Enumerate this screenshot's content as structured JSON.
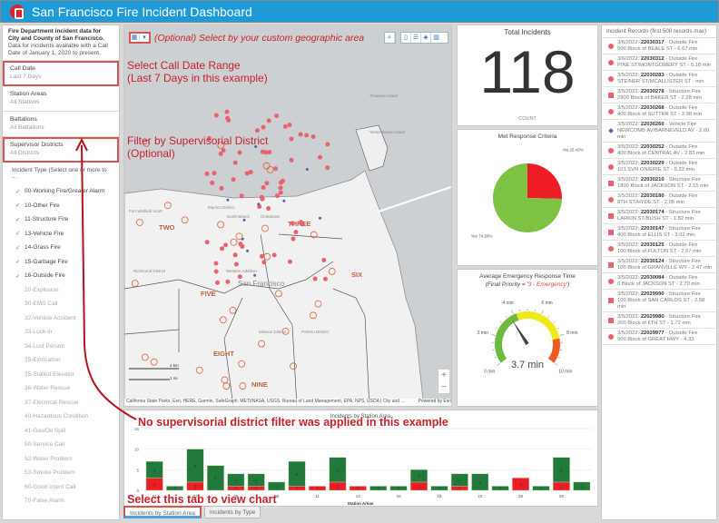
{
  "header": {
    "title": "San Francisco Fire Incident Dashboard"
  },
  "sidebar": {
    "intro_bold": "Fire Department incident data for City and County of San Francisco.",
    "intro": "Data for incidents available with a Call Date of January 1, 2020 to present.",
    "filters": [
      {
        "label": "Call Date",
        "value": "Last 7 Days"
      },
      {
        "label": "Station Areas",
        "value": "All Stations"
      },
      {
        "label": "Battalions",
        "value": "All Battalions"
      },
      {
        "label": "Supervisor Districts",
        "value": "All Districts"
      }
    ],
    "incident_type_label": "Incident Type (Select one or more to ...",
    "types": [
      {
        "label": "00-Working Fire/Greater Alarm",
        "checked": true
      },
      {
        "label": "10-Other Fire",
        "checked": true
      },
      {
        "label": "11-Structure Fire",
        "checked": true
      },
      {
        "label": "13-Vehicle Fire",
        "checked": true
      },
      {
        "label": "14-Grass Fire",
        "checked": true
      },
      {
        "label": "15-Garbage Fire",
        "checked": true
      },
      {
        "label": "16-Outside Fire",
        "checked": true
      },
      {
        "label": "20-Explosion",
        "checked": false
      },
      {
        "label": "30-EMS Call",
        "checked": false
      },
      {
        "label": "32-Vehicle Accident",
        "checked": false
      },
      {
        "label": "33-Lock-in",
        "checked": false
      },
      {
        "label": "34-Lost Person",
        "checked": false
      },
      {
        "label": "35-Extrication",
        "checked": false
      },
      {
        "label": "35-Stalled Elevator",
        "checked": false
      },
      {
        "label": "36-Water Rescue",
        "checked": false
      },
      {
        "label": "37-Electrical Rescue",
        "checked": false
      },
      {
        "label": "40-Hazardous Condition",
        "checked": false
      },
      {
        "label": "41-Gas/Oil Spill",
        "checked": false
      },
      {
        "label": "50-Service Call",
        "checked": false
      },
      {
        "label": "52-Water Problem",
        "checked": false
      },
      {
        "label": "53-Smoke Problem",
        "checked": false
      },
      {
        "label": "60-Good Intent Call",
        "checked": false
      },
      {
        "label": "70-False Alarm",
        "checked": false
      }
    ]
  },
  "map": {
    "districts": [
      "TWO",
      "THREE",
      "FIVE",
      "SIX",
      "EIGHT",
      "NINE"
    ],
    "places": [
      "Marina District",
      "North Beach",
      "Chinatown",
      "Fort Winfield Scott",
      "Richmond District",
      "Western Addition",
      "San Francisco",
      "Mission District",
      "Potrero District",
      "Treasure Island",
      "Yerba Buena Island"
    ],
    "scale": [
      "2 km",
      "1 mi"
    ],
    "attribution": "California State Parks, Esri, HERE, Garmin, SafeGraph, METI/NASA, USGS, Bureau of Land Management, EPA, NPS, USDA | City and ...",
    "powered": "Powered by Esri",
    "zoom_in": "+",
    "zoom_out": "−"
  },
  "annotations": {
    "geo": "(Optional) Select by your custom geographic area",
    "date1": "Select Call Date Range",
    "date2": "(Last 7 Days in this example)",
    "dist1": "Filter by Supervisorial District",
    "dist2": "(Optional)",
    "nofilter": "No supervisorial district filter was applied in this example",
    "tab": "Select this tab to view chart"
  },
  "total": {
    "title": "Total Incidents",
    "value": "118",
    "caption": "COUNT"
  },
  "pie": {
    "title": "Met Response Criteria",
    "slices": [
      {
        "label": "No",
        "pct": 25.42,
        "text": "No 25.42%",
        "color": "#ee1c25"
      },
      {
        "label": "Yes",
        "pct": 74.58,
        "text": "Yes 74.58%",
        "color": "#7dc243"
      }
    ]
  },
  "gauge": {
    "title": "Average Emergency Response Time",
    "subtitle_pre": "(Final Priority = '",
    "subtitle_hl": "3 - Emergency",
    "subtitle_post": "')",
    "value": 3.7,
    "value_text": "3.7 min",
    "min": 0,
    "max": 10,
    "ticks": [
      "0 min",
      "2 min",
      "4 min",
      "6 min",
      "8 min",
      "10 min"
    ],
    "bands": [
      {
        "from": 0,
        "to": 4.2,
        "color": "#6cbb3c"
      },
      {
        "from": 4.2,
        "to": 8.2,
        "color": "#eeea1a"
      },
      {
        "from": 8.2,
        "to": 10,
        "color": "#f05a22"
      }
    ]
  },
  "records": {
    "title": "Incident Records (first 500 records max)",
    "items": [
      {
        "date": "3/6/2022:",
        "id": "22030317",
        "type": " - Outside Fire",
        "loc": "500 Block of BEALE ST - 6.67 min",
        "shape": "circle"
      },
      {
        "date": "3/6/2022:",
        "id": "22030312",
        "type": " - Outside Fire",
        "loc": "PINE ST/MONTGOMERY ST - 5.18 min",
        "shape": "circle"
      },
      {
        "date": "3/5/2022:",
        "id": "22030283",
        "type": " - Outside Fire",
        "loc": "STEINER ST/MCALLISTER ST -  min",
        "shape": "circle"
      },
      {
        "date": "3/5/2022:",
        "id": "22030278",
        "type": " - Structure Fire",
        "loc": "2900 Block of BAKER ST - 2.28 min",
        "shape": "square"
      },
      {
        "date": "3/5/2022:",
        "id": "22030268",
        "type": " - Outside Fire",
        "loc": "400 Block of SUTTER ST - 3.98 min",
        "shape": "circle"
      },
      {
        "date": "3/5/2022:",
        "id": "22030260",
        "type": " - Vehicle Fire",
        "loc": "NEWCOMB AV/BARNEVELD AV - 2.60 min",
        "shape": "diamond"
      },
      {
        "date": "3/5/2022:",
        "id": "22030252",
        "type": " - Outside Fire",
        "loc": "400 Block of CENTRAL AV - 2.83 min",
        "shape": "circle"
      },
      {
        "date": "3/5/2022:",
        "id": "22030229",
        "type": " - Outside Fire",
        "loc": "101 SVN ON/ERIE ST - 5.22 min",
        "shape": "circle"
      },
      {
        "date": "3/5/2022:",
        "id": "22030210",
        "type": " - Structure Fire",
        "loc": "1800 Block of JACKSON ST - 2.15 min",
        "shape": "square"
      },
      {
        "date": "3/5/2022:",
        "id": "22030180",
        "type": " - Outside Fire",
        "loc": "8TH ST/HYDE ST - 2.05 min",
        "shape": "circle"
      },
      {
        "date": "3/5/2022:",
        "id": "22030174",
        "type": " - Structure Fire",
        "loc": "LARKIN ST/BUSH ST - 1.82 min",
        "shape": "square"
      },
      {
        "date": "3/5/2022:",
        "id": "22030147",
        "type": " - Structure Fire",
        "loc": "400 Block of ELLIS ST - 3.02 min",
        "shape": "square"
      },
      {
        "date": "3/5/2022:",
        "id": "22030125",
        "type": " - Outside Fire",
        "loc": "100 Block of FULTON ST - 2.67 min",
        "shape": "circle"
      },
      {
        "date": "3/5/2022:",
        "id": "22030124",
        "type": " - Structure Fire",
        "loc": "100 Block of GRANVILLE WY - 2.47 min",
        "shape": "square"
      },
      {
        "date": "3/5/2022:",
        "id": "22030084",
        "type": " - Outside Fire",
        "loc": "0 Block of JACKSON ST - 2.70 min",
        "shape": "circle"
      },
      {
        "date": "3/5/2022:",
        "id": "22029990",
        "type": " - Structure Fire",
        "loc": "100 Block of SAN CARLOS ST - 2.58 min",
        "shape": "square"
      },
      {
        "date": "3/5/2022:",
        "id": "22029980",
        "type": " - Structure Fire",
        "loc": "200 Block of 6TH ST - 1.72 min",
        "shape": "square"
      },
      {
        "date": "3/5/2022:",
        "id": "22029977",
        "type": " - Outside Fire",
        "loc": "900 Block of GREAT HWY - 4.33",
        "shape": "circle"
      }
    ]
  },
  "chart_data": {
    "type": "bar",
    "stacked": true,
    "title": "Incidents by Station Area",
    "xlabel": "Station Areas",
    "ylabel": "",
    "ylim": [
      0,
      15
    ],
    "yticks": [
      0,
      5,
      10,
      15
    ],
    "grid": true,
    "tick_labels": [
      "01",
      "03",
      "06",
      "08",
      "11",
      "14",
      "16",
      "18",
      "22",
      "28",
      "29"
    ],
    "series": [
      {
        "color": "#ee1c25",
        "values": [
          3,
          0,
          2,
          0,
          1,
          1,
          0,
          1,
          1,
          2,
          1,
          0,
          0,
          2,
          0,
          1,
          0,
          0,
          3,
          0,
          2,
          0
        ]
      },
      {
        "color": "#217a3b",
        "values": [
          4,
          1,
          8,
          6,
          3,
          3,
          2,
          6,
          0,
          6,
          0,
          1,
          1,
          3,
          1,
          3,
          4,
          1,
          0,
          1,
          6,
          2
        ]
      }
    ]
  },
  "tabs": [
    {
      "label": "Incidents by Station Area",
      "active": true
    },
    {
      "label": "Incidents by Type",
      "active": false
    }
  ]
}
